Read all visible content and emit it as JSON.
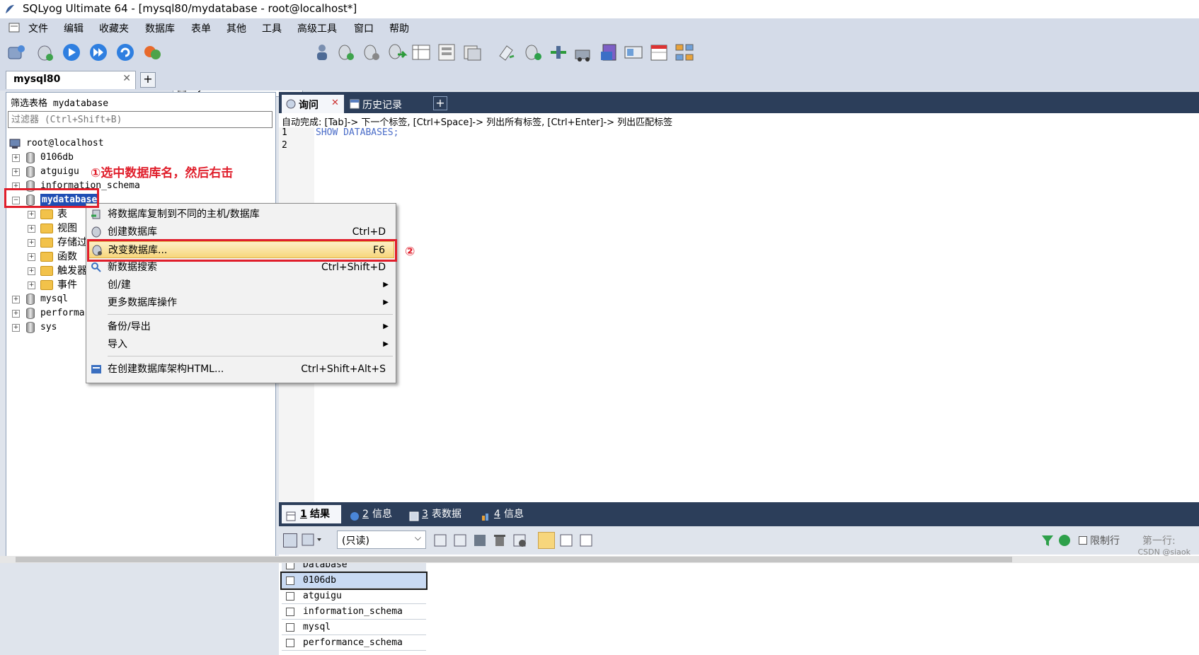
{
  "window": {
    "title": "SQLyog Ultimate 64 - [mysql80/mydatabase - root@localhost*]"
  },
  "menu": [
    "文件",
    "编辑",
    "收藏夹",
    "数据库",
    "表单",
    "其他",
    "工具",
    "高级工具",
    "窗口",
    "帮助"
  ],
  "toolbar": {
    "database_select": "mydatabase"
  },
  "connection_tab": {
    "label": "mysql80",
    "close": "✕",
    "add": "+"
  },
  "left_panel": {
    "filter_label": "筛选表格 mydatabase",
    "filter_placeholder": "过滤器 (Ctrl+Shift+B)",
    "root": "root@localhost",
    "databases": [
      "0106db",
      "atguigu",
      "information_schema",
      "mydatabase",
      "mysql",
      "performa",
      "sys"
    ],
    "children": [
      "表",
      "视图",
      "存储过",
      "函数",
      "触发器",
      "事件"
    ]
  },
  "annotations": {
    "step1": "①选中数据库名，然后右击",
    "step2": "②"
  },
  "context_menu": {
    "items": [
      {
        "label": "将数据库复制到不同的主机/数据库",
        "shortcut": ""
      },
      {
        "label": "创建数据库",
        "shortcut": "Ctrl+D"
      },
      {
        "label": "改变数据库...",
        "shortcut": "F6"
      },
      {
        "label": "新数据搜索",
        "shortcut": "Ctrl+Shift+D"
      },
      {
        "label": "创/建",
        "shortcut": ""
      },
      {
        "label": "更多数据库操作",
        "shortcut": ""
      },
      {
        "label": "备份/导出",
        "shortcut": ""
      },
      {
        "label": "导入",
        "shortcut": ""
      },
      {
        "label": "在创建数据库架构HTML...",
        "shortcut": "Ctrl+Shift+Alt+S"
      }
    ]
  },
  "query_tabs": {
    "query": "询问",
    "history": "历史记录",
    "close": "✕",
    "add": "+"
  },
  "editor": {
    "autocomplete_hint": "自动完成: [Tab]-> 下一个标签, [Ctrl+Space]-> 列出所有标签, [Ctrl+Enter]-> 列出匹配标签",
    "line1": "1",
    "line2": "2",
    "code": "SHOW DATABASES;"
  },
  "result_tabs": [
    {
      "num": "1",
      "label": "结果"
    },
    {
      "num": "2",
      "label": "信息"
    },
    {
      "num": "3",
      "label": "表数据"
    },
    {
      "num": "4",
      "label": "信息"
    }
  ],
  "result_toolbar": {
    "mode": "(只读)",
    "limit": "限制行",
    "first_row": "第一行:"
  },
  "results": {
    "column": "Database",
    "rows": [
      "0106db",
      "atguigu",
      "information_schema",
      "mysql",
      "performance_schema"
    ]
  },
  "watermark": "CSDN @siaok",
  "colors": {
    "annotation": "#e01e2b",
    "highlight": "#f7d67c",
    "selection": "#1f4eb4"
  }
}
